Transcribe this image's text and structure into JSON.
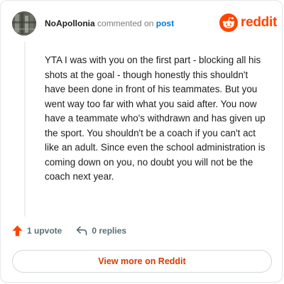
{
  "comment": {
    "author": "NoApollonia",
    "action_text": "commented on",
    "post_link": "post",
    "body": "YTA I was with you on the first part - blocking all his shots at the goal - though honestly this shouldn't have been done in front of his teammates. But you went way too far with what you said after. You now have a teammate who's withdrawn and has given up the sport. You shouldn't be a coach if you can't act like an adult. Since even the school administration is coming down on you, no doubt you will not be the coach next year."
  },
  "brand": {
    "name": "reddit",
    "color": "#ff4500"
  },
  "footer": {
    "upvotes": "1 upvote",
    "replies": "0 replies",
    "view_more": "View more on Reddit"
  },
  "icons": {
    "avatar": "user-avatar",
    "logo": "reddit-snoo-icon",
    "upvote": "upvote-arrow-icon",
    "reply": "reply-arrow-icon"
  },
  "colors": {
    "link": "#0079d3",
    "upvote": "#ff4500",
    "view_more_text": "#d93a00",
    "muted": "#576f76"
  }
}
